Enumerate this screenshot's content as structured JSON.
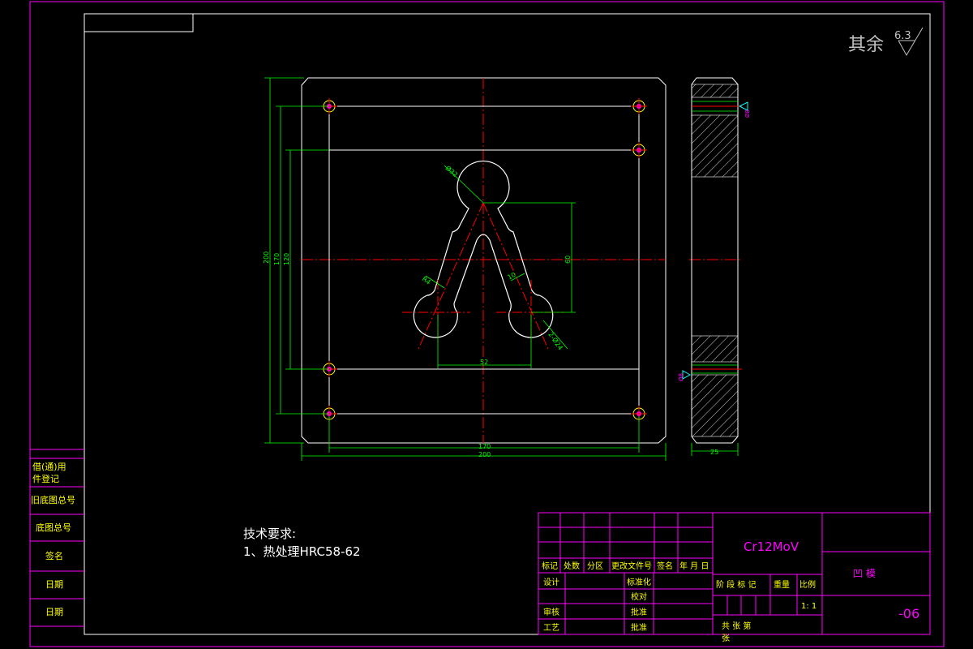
{
  "surface_finish": {
    "label": "其余",
    "value": "6.3"
  },
  "dimensions": {
    "width_total": "200",
    "height_total": "200",
    "hole_span_h": "170",
    "hole_span_v": "170",
    "inner_span_v": "120",
    "center_distance": "52",
    "height_60": "60",
    "dia_32": "Ø32",
    "r_4": "R4",
    "width_10": "10",
    "dia_24": "2-Ø24",
    "thickness": "25",
    "hole_dia_side_top": "Ø8",
    "hole_dia_side_bottom": "Ø8"
  },
  "left_margin": {
    "row1": "借(通)用",
    "row2": "件登记",
    "row3": "旧底图总号",
    "row4": "底图总号",
    "row5": "签名",
    "row6": "日期",
    "row7": "日期"
  },
  "tech_requirements": {
    "title": "技术要求:",
    "item1": "1、热处理HRC58-62"
  },
  "title_block": {
    "material": "Cr12MoV",
    "part_name": "凹 模",
    "drawing_number": "-06",
    "scale": "1: 1",
    "rev_headers": [
      "标记",
      "处数",
      "分区",
      "更改文件号",
      "签名",
      "年 月 日"
    ],
    "design": "设计",
    "standardization": "标准化",
    "check": "审核",
    "proof": "校对",
    "process": "工艺",
    "approve": "批准",
    "stage_label": "阶 段 标 记",
    "weight_label": "重量",
    "scale_label": "比例",
    "sheets_label": "共   张   第",
    "sheet_label": "张"
  },
  "colors": {
    "frame": "#ff00ff",
    "outline": "#ffffff",
    "dimension": "#00ff00",
    "centerline": "#ff0000",
    "text_yellow": "#ffff00"
  }
}
